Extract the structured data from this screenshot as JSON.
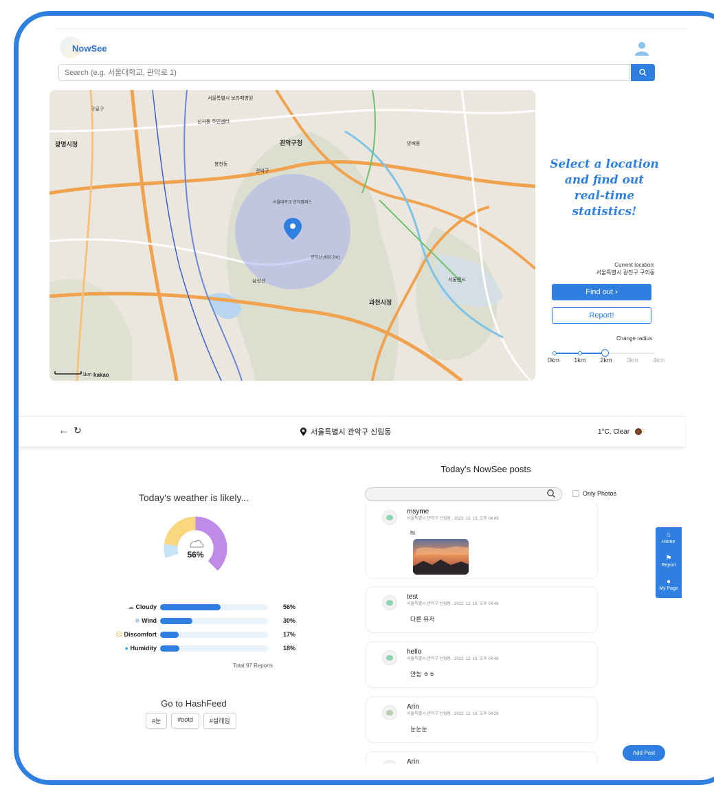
{
  "header": {
    "logo_text": "NowSee",
    "search_placeholder": "Search (e.g. 서울대학교, 관악로 1)"
  },
  "map": {
    "labels": [
      "서울특별시 보라매병원",
      "신사동 주민센터",
      "관악구청",
      "서울대학교 관악캠퍼스",
      "관악산 (632.2m)",
      "삼성산",
      "과천시청",
      "광명시청",
      "서울랜드",
      "관악구",
      "봉천동",
      "구로구",
      "방배동"
    ],
    "scale_text": "1km",
    "attribution": "kakao"
  },
  "promo": {
    "text": "Select a location and find out real-time statistics!"
  },
  "controls": {
    "current_location_label": "Current location:",
    "current_location_value": "서울특별시 광진구 구의동",
    "find_out_label": "Find out  ›",
    "report_label": "Report!",
    "change_radius_label": "Change radius",
    "radius_ticks": [
      "0km",
      "1km",
      "2km",
      "3km",
      "4km"
    ],
    "radius_selected": "2km"
  },
  "location_bar": {
    "location": "서울특별시 관악구 신림동",
    "weather": "1°C, Clear"
  },
  "weather": {
    "title": "Today's weather is likely...",
    "donut_center": "56%",
    "bars": [
      {
        "label": "Cloudy",
        "pct": "56%",
        "value": 56,
        "icon": "cloud-icon"
      },
      {
        "label": "Wind",
        "pct": "30%",
        "value": 30,
        "icon": "wind-icon"
      },
      {
        "label": "Discomfort",
        "pct": "17%",
        "value": 17,
        "icon": "face-icon"
      },
      {
        "label": "Humidity",
        "pct": "18%",
        "value": 18,
        "icon": "droplet-icon"
      }
    ],
    "total": "Total 97 Reports"
  },
  "hashfeed": {
    "title": "Go to HashFeed",
    "tags": [
      "#눈",
      "#ootd",
      "#설레임"
    ]
  },
  "posts": {
    "title": "Today's NowSee posts",
    "only_photos_label": "Only Photos",
    "items": [
      {
        "name": "msyme",
        "meta": "서울특별시 관악구 신림동 , 2022. 12. 10. 오후 04:49",
        "body": "hi",
        "has_image": true
      },
      {
        "name": "test",
        "meta": "서울특별시 관악구 신림동 , 2022. 12. 10. 오후 04:48",
        "body": "다른 유저",
        "has_image": false
      },
      {
        "name": "hello",
        "meta": "서울특별시 관악구 신림동 , 2022. 12. 10. 오후 04:46",
        "body": "안농 ㅎㅎ",
        "has_image": false
      },
      {
        "name": "Arin",
        "meta": "서울특별시 관악구 신림동 , 2022. 12. 10. 오후 04:29",
        "body": "눈눈눈",
        "has_image": false
      },
      {
        "name": "Arin",
        "meta": "",
        "body": "",
        "has_image": false
      }
    ],
    "add_post_label": "Add Post"
  },
  "sidenav": {
    "items": [
      {
        "label": "Home",
        "icon": "home-icon"
      },
      {
        "label": "Report",
        "icon": "megaphone-icon"
      },
      {
        "label": "My Page",
        "icon": "person-icon"
      }
    ]
  },
  "colors": {
    "primary": "#2f7fe0",
    "donut_cloudy": "#c08ae8",
    "donut_discomfort": "#f9d77e",
    "donut_wind": "#c6e4f7"
  }
}
